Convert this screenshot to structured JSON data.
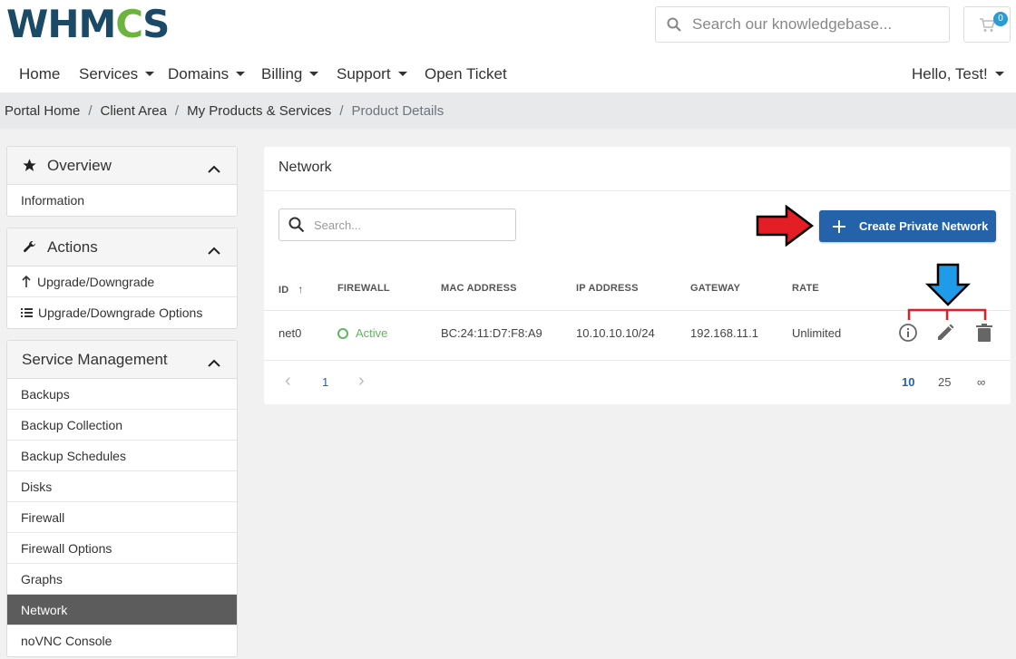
{
  "brand": {
    "logo_start": "WHM",
    "logo_gear": "C",
    "logo_end": "S"
  },
  "header": {
    "search_placeholder": "Search our knowledgebase...",
    "cart_count": "0"
  },
  "nav": {
    "home": "Home",
    "services": "Services",
    "domains": "Domains",
    "billing": "Billing",
    "support": "Support",
    "open_ticket": "Open Ticket",
    "user": "Hello, Test!"
  },
  "breadcrumb": {
    "portal_home": "Portal Home",
    "client_area": "Client Area",
    "my_products": "My Products & Services",
    "current": "Product Details",
    "separator": "/"
  },
  "sidebar": {
    "overview": {
      "title": "Overview",
      "items": [
        "Information"
      ]
    },
    "actions": {
      "title": "Actions",
      "items": [
        "Upgrade/Downgrade",
        "Upgrade/Downgrade Options"
      ]
    },
    "service_management": {
      "title": "Service Management",
      "items": [
        "Backups",
        "Backup Collection",
        "Backup Schedules",
        "Disks",
        "Firewall",
        "Firewall Options",
        "Graphs",
        "Network",
        "noVNC Console"
      ],
      "active": "Network"
    }
  },
  "network": {
    "title": "Network",
    "search_placeholder": "Search...",
    "create_button": "Create Private Network",
    "columns": {
      "id": "ID",
      "sort_arrow": "↑",
      "firewall": "FIREWALL",
      "mac": "MAC ADDRESS",
      "ip": "IP ADDRESS",
      "gateway": "GATEWAY",
      "rate": "RATE"
    },
    "rows": [
      {
        "id": "net0",
        "firewall": "Active",
        "mac": "BC:24:11:D7:F8:A9",
        "ip": "10.10.10.10/24",
        "gateway": "192.168.11.1",
        "rate": "Unlimited"
      }
    ],
    "pagination": {
      "prev": "‹",
      "page": "1",
      "next": "›",
      "per_page": [
        "10",
        "25",
        "∞"
      ],
      "selected_per_page": "10"
    }
  },
  "colors": {
    "primary": "#2463aa",
    "active_green": "#5cb85c",
    "logo_blue": "#1a4a66",
    "logo_green": "#6cb33f",
    "annotation_red": "#e31e24",
    "annotation_blue": "#1e9be9"
  }
}
